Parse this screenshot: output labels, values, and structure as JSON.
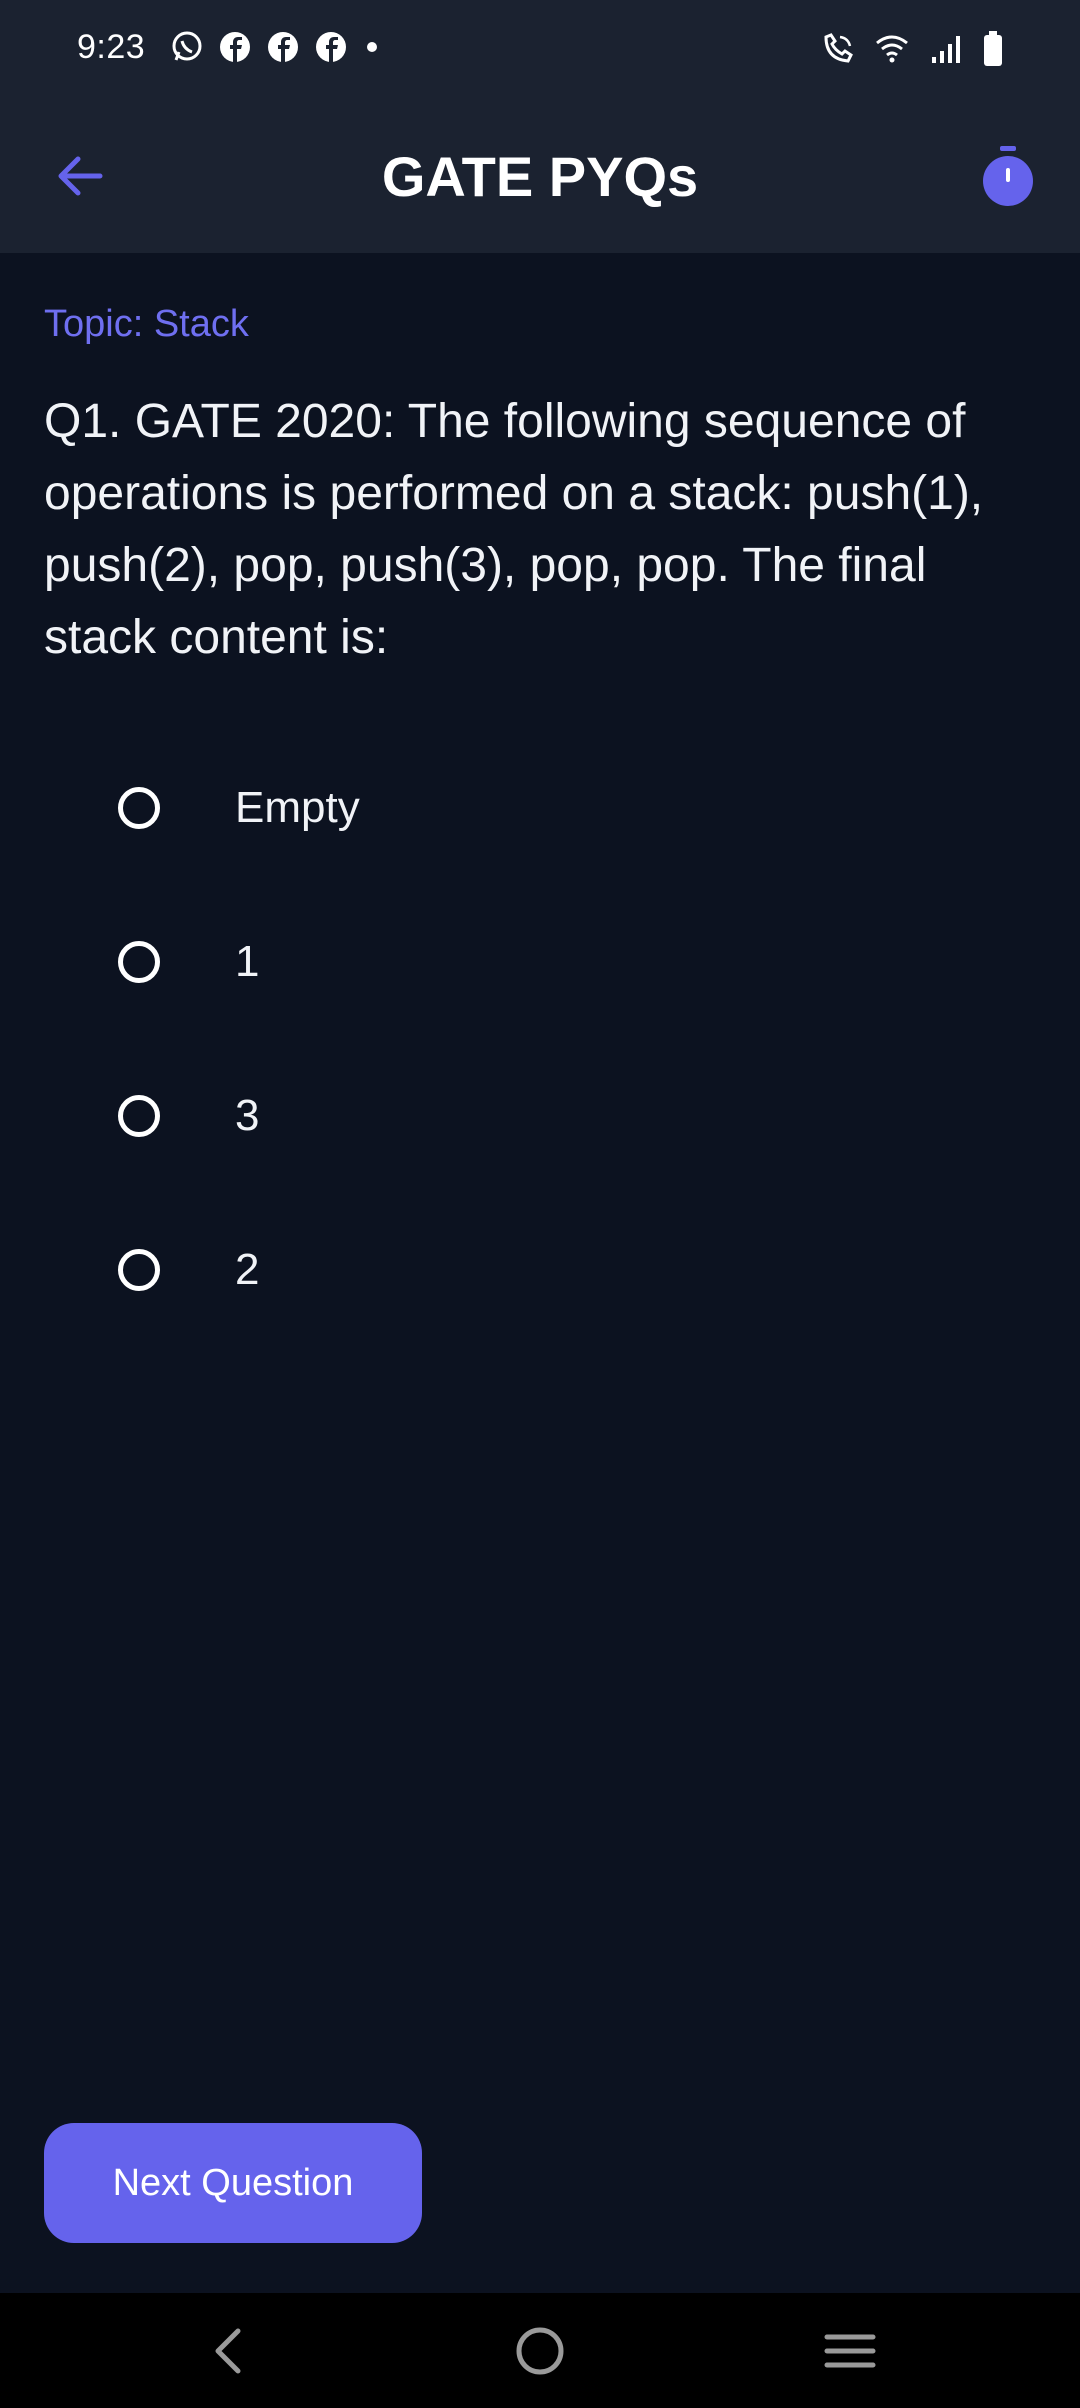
{
  "status_bar": {
    "time": "9:23",
    "left_icons": [
      "whatsapp-icon",
      "facebook-icon",
      "facebook-icon",
      "facebook-icon",
      "dot-icon"
    ],
    "right_icons": [
      "wifi-calling-icon",
      "wifi-icon",
      "signal-icon",
      "battery-icon"
    ]
  },
  "app_bar": {
    "title": "GATE PYQs",
    "back_icon": "arrow-left-icon",
    "timer_icon": "stopwatch-icon"
  },
  "quiz": {
    "topic": "Topic: Stack",
    "question": "Q1. GATE 2020: The following sequence of operations is performed on a stack: push(1), push(2), pop, push(3), pop, pop. The final stack content is:",
    "options": [
      {
        "label": "Empty",
        "selected": false
      },
      {
        "label": "1",
        "selected": false
      },
      {
        "label": "3",
        "selected": false
      },
      {
        "label": "2",
        "selected": false
      }
    ],
    "next_button": "Next Question"
  },
  "nav_bar": {
    "items": [
      "back-nav-icon",
      "home-nav-icon",
      "recents-nav-icon"
    ]
  },
  "colors": {
    "accent": "#6563ec",
    "background": "#0c1220",
    "bar": "#1b2230"
  }
}
